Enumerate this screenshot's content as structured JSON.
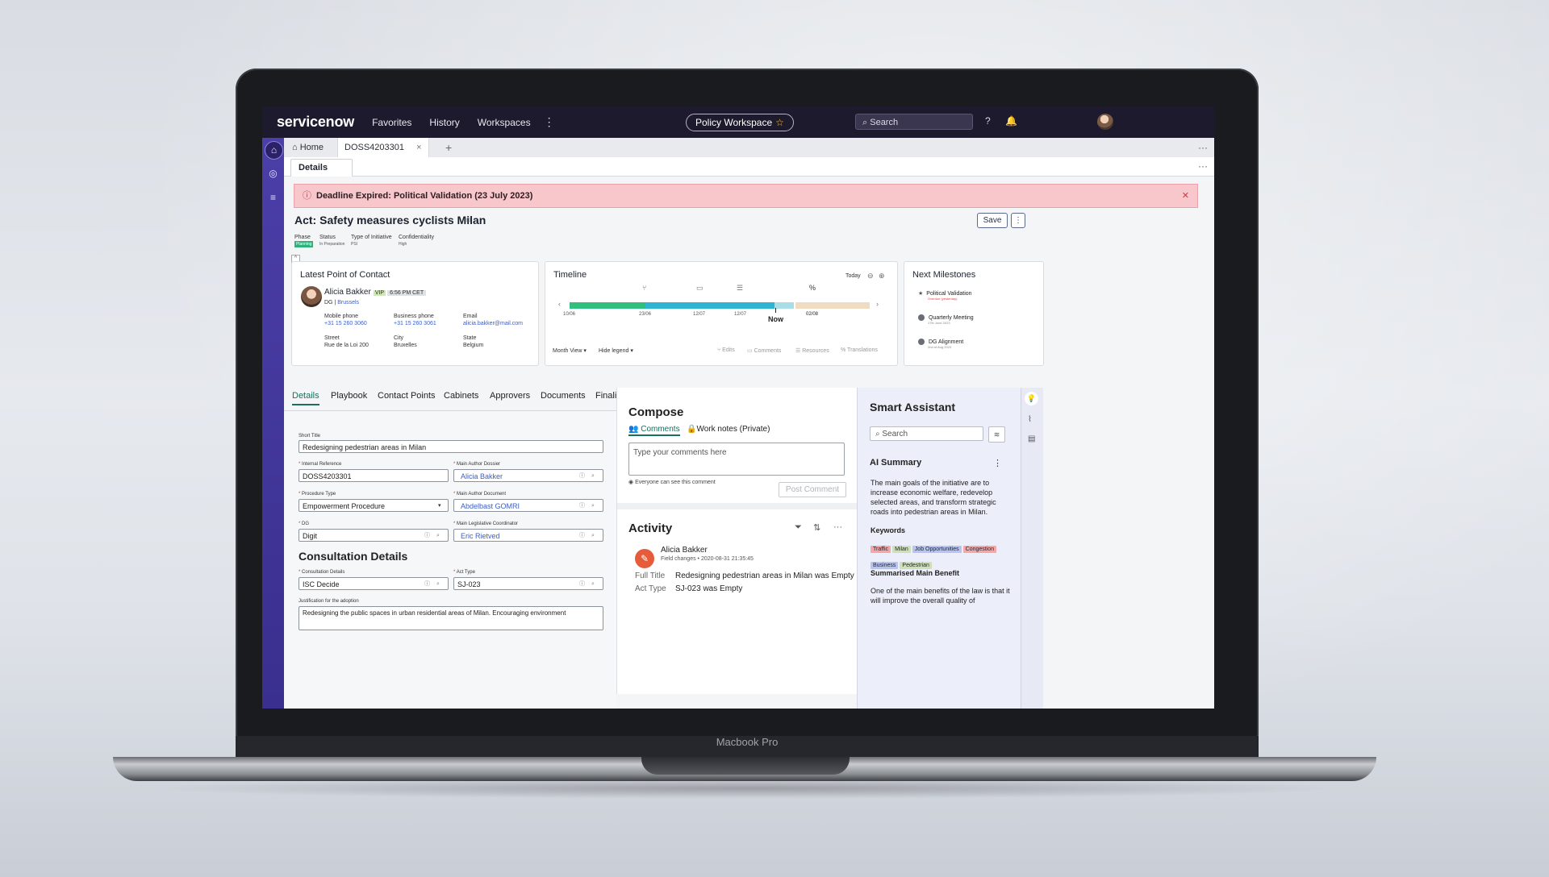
{
  "device": {
    "model_label": "Macbook Pro"
  },
  "topnav": {
    "logo": "servicenow",
    "links": [
      "Favorites",
      "History",
      "Workspaces"
    ],
    "workspace": "Policy Workspace",
    "search_placeholder": "Search"
  },
  "tabs": {
    "home": "Home",
    "record": "DOSS4203301"
  },
  "subtab": "Details",
  "alert": {
    "text": "Deadline Expired: Political Validation (23 July 2023)"
  },
  "record": {
    "title": "Act: Safety measures cyclists Milan",
    "save_label": "Save",
    "meta": [
      {
        "label": "Phase",
        "value": "Planning"
      },
      {
        "label": "Status",
        "value": "In Preparation"
      },
      {
        "label": "Type of Initiative",
        "value": "PSI"
      },
      {
        "label": "Confidentiality",
        "value": "High"
      }
    ]
  },
  "contact": {
    "title": "Latest Point of Contact",
    "name": "Alicia Bakker",
    "vip": "VIP",
    "time": "6:56 PM CET",
    "dg": "DG |",
    "city_link": "Brussels",
    "mobile_label": "Mobile phone",
    "mobile": "+31 15 260 3060",
    "business_label": "Business phone",
    "business": "+31 15 260 3061",
    "email_label": "Email",
    "email": "alicia.bakker@mail.com",
    "street_label": "Street",
    "street": "Rue de la Loi 200",
    "city_label": "City",
    "city": "Bruxelles",
    "state_label": "State",
    "state": "Belgium"
  },
  "timeline": {
    "title": "Timeline",
    "today": "Today",
    "dates": [
      "10/06",
      "23/06",
      "12/07",
      "12/07",
      "02/08"
    ],
    "now": "Now",
    "month_view": "Month View",
    "hide_legend": "Hide legend",
    "legend": [
      "Edits",
      "Comments",
      "Resources",
      "Translations"
    ]
  },
  "milestones": {
    "title": "Next Milestones",
    "items": [
      {
        "name": "Political Validation",
        "sub": "Overdue (yesterday)"
      },
      {
        "name": "Quarterly Meeting",
        "sub": "17th June 2023"
      },
      {
        "name": "DG Alignment",
        "sub": "2nd of Aug 2023"
      }
    ]
  },
  "main_tabs": [
    "Details",
    "Playbook",
    "Contact Points",
    "Cabinets",
    "Approvers",
    "Documents",
    "Finality"
  ],
  "form": {
    "short_title_label": "Short Title",
    "short_title": "Redesigning pedestrian areas in Milan",
    "internal_ref_label": "Internal Reference",
    "internal_ref": "DOSS4203301",
    "main_author_dossier_label": "Main Author Dossier",
    "main_author_dossier": "Alicia Bakker",
    "procedure_type_label": "Procedure Type",
    "procedure_type": "Empowerment Procedure",
    "main_author_document_label": "Main Author Document",
    "main_author_document": "Abdelbast GOMRI",
    "dg_label": "DG",
    "dg": "Digit",
    "coordinator_label": "Main Legislative Coordinator",
    "coordinator": "Eric Rietved",
    "consultation_heading": "Consultation Details",
    "consultation_label": "Consultation Details",
    "consultation": "ISC Decide",
    "act_type_label": "Act Type",
    "act_type": "SJ-023",
    "justification_label": "Justification for the adoption",
    "justification": "Redesigning the public spaces in urban residential areas of Milan. Encouraging environment"
  },
  "compose": {
    "title": "Compose",
    "tab_comments": "Comments",
    "tab_work_notes": "Work notes (Private)",
    "placeholder": "Type your comments here",
    "visibility": "Everyone can see this comment",
    "post": "Post Comment"
  },
  "activity": {
    "title": "Activity",
    "author": "Alicia Bakker",
    "kind": "Field changes",
    "timestamp": "2020-08-31 21:35:45",
    "changes": [
      {
        "field": "Full Title",
        "value": "Redesigning pedestrian areas in Milan was Empty"
      },
      {
        "field": "Act Type",
        "value": "SJ-023 was Empty"
      }
    ]
  },
  "assistant": {
    "title": "Smart Assistant",
    "search_placeholder": "Search",
    "ai_summary_title": "AI Summary",
    "summary": "The main goals of the initiative are to increase economic welfare, redevelop selected areas, and transform strategic roads into pedestrian areas in Milan.",
    "keywords_title": "Keywords",
    "keywords": [
      {
        "label": "Traffic",
        "color": "#f3a7a7"
      },
      {
        "label": "Milan",
        "color": "#cfe0b8"
      },
      {
        "label": "Job Opportunities",
        "color": "#b7c3f0"
      },
      {
        "label": "Congestion",
        "color": "#f3a7a7"
      },
      {
        "label": "Business",
        "color": "#b7c3f0"
      },
      {
        "label": "Pedestrian",
        "color": "#cfe0b8"
      }
    ],
    "benefit_title": "Summarised Main Benefit",
    "benefit": "One of the main benefits of the law is that it will improve the overall quality of"
  },
  "colors": {
    "accent": "#1a6f5a",
    "nav": "#1e1a2e",
    "rail": "#4b3fa8",
    "alert": "#f7c7cc"
  }
}
